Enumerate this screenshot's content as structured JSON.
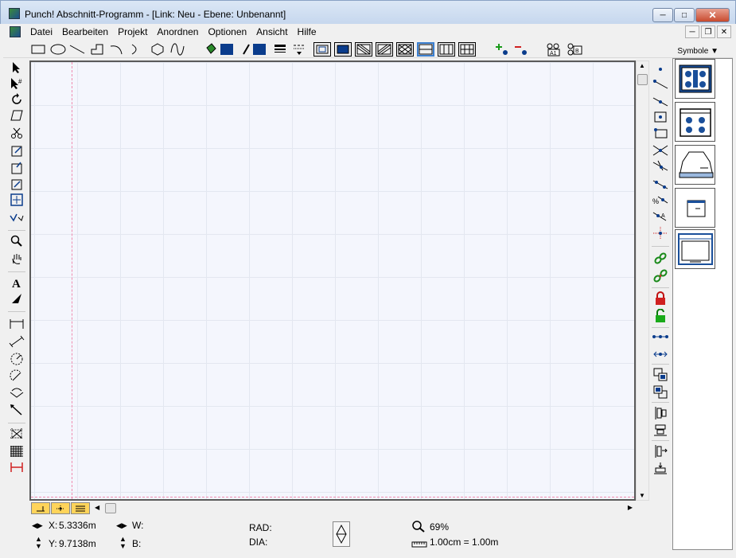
{
  "window": {
    "title": "Punch! Abschnitt-Programm - [Link: Neu  -  Ebene:  Unbenannt]",
    "icon": "app-icon"
  },
  "menu": {
    "items": [
      "Datei",
      "Bearbeiten",
      "Projekt",
      "Anordnen",
      "Optionen",
      "Ansicht",
      "Hilfe"
    ]
  },
  "toolbar": {
    "symbole_label": "Symbole",
    "layer_labels": [
      "A1",
      "B"
    ]
  },
  "status": {
    "x_label": "X:",
    "x_value": "5.3336m",
    "y_label": "Y:",
    "y_value": "9.7138m",
    "w_label": "W:",
    "b_label": "B:",
    "rad_label": "RAD:",
    "dia_label": "DIA:",
    "zoom": "69%",
    "scale": "1.00cm =  1.00m"
  },
  "colors": {
    "accent": "#0a3c8c",
    "canvas_bg": "#f4f6fd",
    "guide": "#f08cb0"
  }
}
